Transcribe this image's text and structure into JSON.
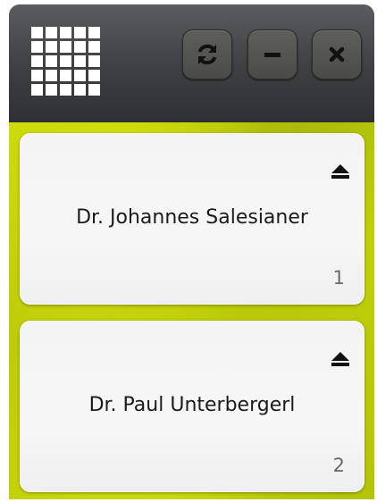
{
  "titlebar": {
    "menu_icon": "grid-icon",
    "buttons": [
      {
        "icon": "refresh-icon"
      },
      {
        "icon": "minimize-icon"
      },
      {
        "icon": "close-icon"
      }
    ]
  },
  "entries": [
    {
      "name": "Dr. Johannes Salesianer",
      "number": "1",
      "icon": "eject-icon"
    },
    {
      "name": "Dr. Paul Unterbergerl",
      "number": "2",
      "icon": "eject-icon"
    }
  ],
  "colors": {
    "titlebar": "#3d3f43",
    "background": "#c4d40a",
    "card": "#f4f4f4"
  }
}
